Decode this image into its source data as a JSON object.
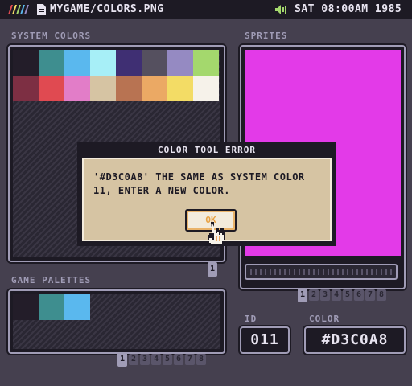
{
  "topbar": {
    "file_path": "MYGAME/COLORS.PNG",
    "clock": "SAT 08:00AM 1985",
    "icons": [
      "rainbow-logo-icon",
      "file-icon",
      "speaker-icon"
    ]
  },
  "system_colors": {
    "label": "SYSTEM COLORS",
    "swatches": [
      "#231d29",
      "#3e8e8f",
      "#5ab8ee",
      "#a7eff7",
      "#3f2f73",
      "#55505f",
      "#958ac2",
      "#a4d86d",
      "#7d2f43",
      "#e04a51",
      "#e27dc8",
      "#d6c4a3",
      "#b87352",
      "#eba964",
      "#f3dc65",
      "#f6f2ea"
    ],
    "page_tab": "1"
  },
  "sprites": {
    "label": "SPRITES",
    "canvas_color": "#e33ae8",
    "page_tabs": [
      "1",
      "2",
      "3",
      "4",
      "5",
      "6",
      "7",
      "8"
    ]
  },
  "game_palettes": {
    "label": "GAME PALETTES",
    "swatches": [
      "#231d29",
      "#3e8e8f",
      "#5ab8ee"
    ],
    "page_tabs": [
      "1",
      "2",
      "3",
      "4",
      "5",
      "6",
      "7",
      "8"
    ]
  },
  "id_field": {
    "label": "ID",
    "value": "011"
  },
  "color_field": {
    "label": "COLOR",
    "value": "#D3C0A8"
  },
  "modal": {
    "title": "COLOR TOOL ERROR",
    "message": "'#D3C0A8' THE SAME AS SYSTEM COLOR\n11, ENTER A NEW COLOR.",
    "ok_label": "OK"
  }
}
